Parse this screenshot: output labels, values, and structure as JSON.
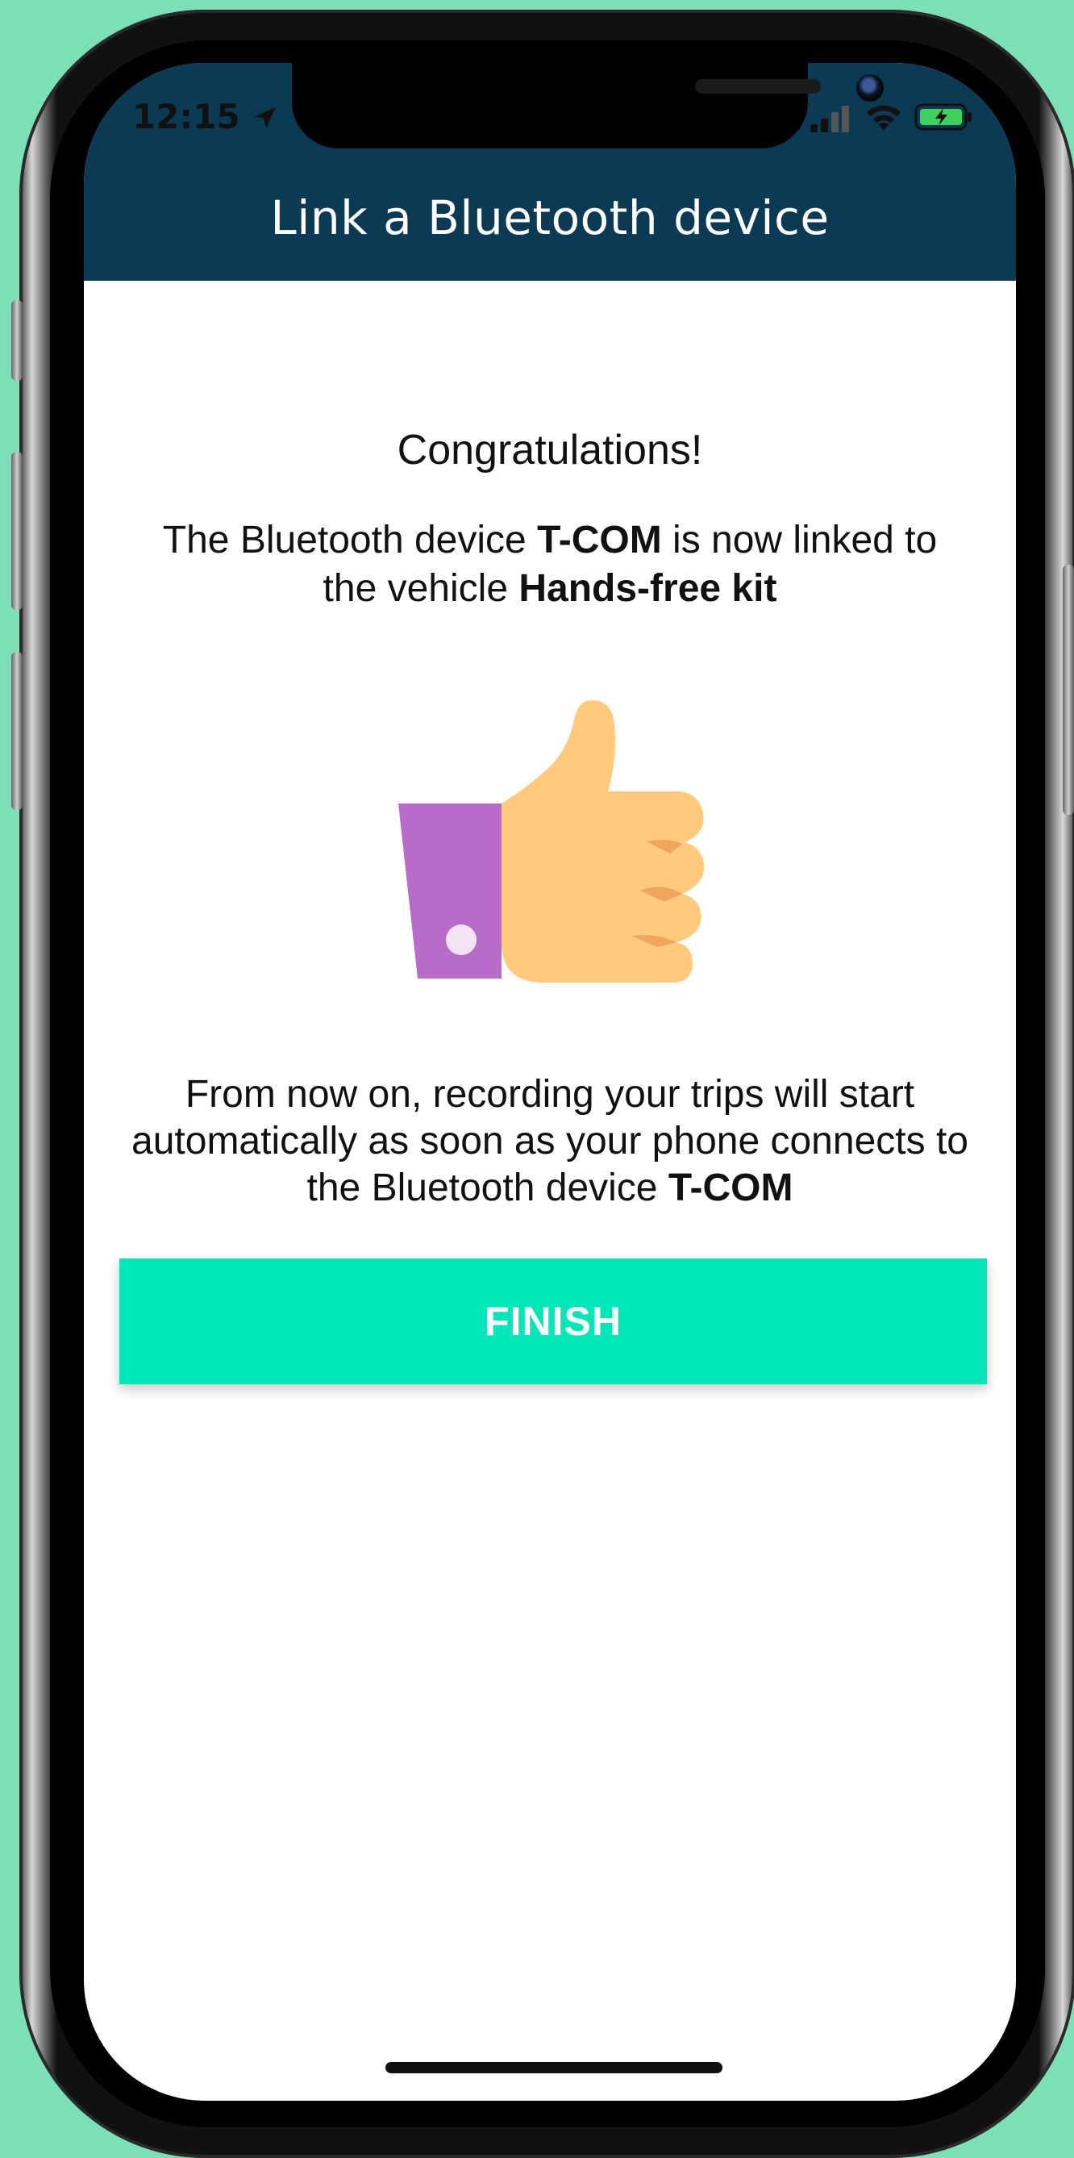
{
  "colors": {
    "background": "#7be0b5",
    "header": "#0b3a55",
    "accent": "#00e8b8",
    "sleeve": "#b86bc8",
    "hand": "#ffca7c",
    "hand_shadow": "#f0a65c"
  },
  "status_bar": {
    "time": "12:15",
    "icons": [
      "location-arrow-icon",
      "signal-icon",
      "wifi-icon",
      "battery-charging-icon"
    ]
  },
  "header": {
    "title": "Link a Bluetooth device"
  },
  "main": {
    "congrats": "Congratulations!",
    "linked": {
      "prefix": "The Bluetooth device ",
      "device": "T-COM",
      "middle": " is now linked to the vehicle ",
      "vehicle": "Hands-free kit"
    },
    "illustration": "thumbs-up-icon",
    "auto": {
      "text": "From now on, recording your trips will start automatically as soon as your phone connects to the Bluetooth device ",
      "device": "T-COM"
    },
    "finish_label": "FINISH"
  }
}
